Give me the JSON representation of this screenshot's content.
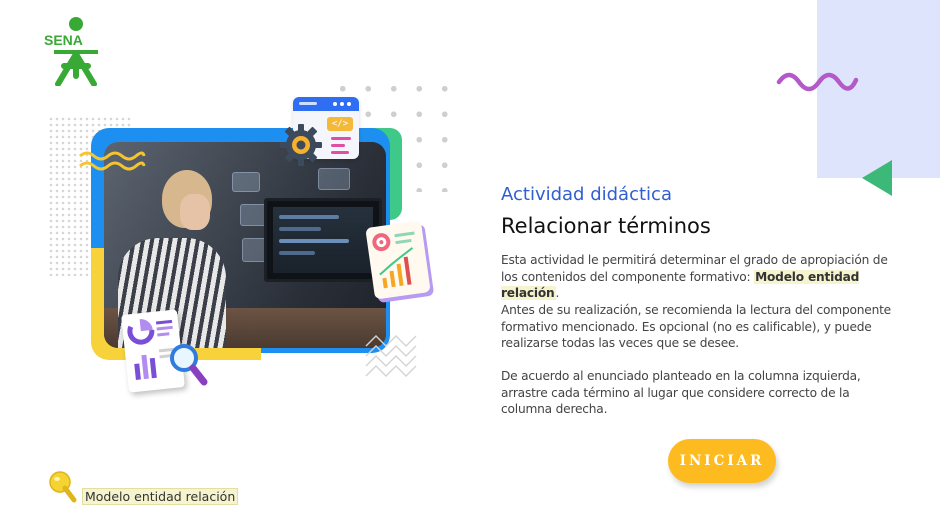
{
  "logo": {
    "text": "SENA",
    "icon": "sena-logo-icon",
    "color": "#39a935"
  },
  "illustration": {
    "code_tag": "</>",
    "icons": [
      "gear-icon",
      "code-window-icon",
      "chart-document-icon",
      "magnifier-icon"
    ],
    "colors": {
      "blue": "#1d8ff0",
      "green": "#3ec988",
      "yellow": "#f7d23a",
      "purple": "#b79af1"
    }
  },
  "content": {
    "eyebrow": "Actividad didáctica",
    "title": "Relacionar términos",
    "paragraph1_text": "Esta actividad le permitirá determinar el grado de apropiación de los contenidos del componente formativo: ",
    "paragraph1_highlight": "Modelo entidad relación",
    "paragraph1_end": ".",
    "paragraph2": "Antes de su realización, se recomienda la lectura del componente formativo mencionado.  Es opcional (no es calificable), y puede realizarse todas las veces que se desee.",
    "paragraph3": "De acuerdo al enunciado planteado en la columna izquierda, arrastre cada término al lugar que considere correcto de la columna derecha."
  },
  "actions": {
    "start_label": "INICIAR",
    "start_color": "#fdbb20"
  },
  "footer": {
    "note_label": "Modelo entidad relación",
    "pin_icon": "pushpin-icon"
  },
  "decor": {
    "panel_color": "#dde4fb",
    "wave_color": "#b35ac8",
    "triangle_color": "#3cb878"
  }
}
